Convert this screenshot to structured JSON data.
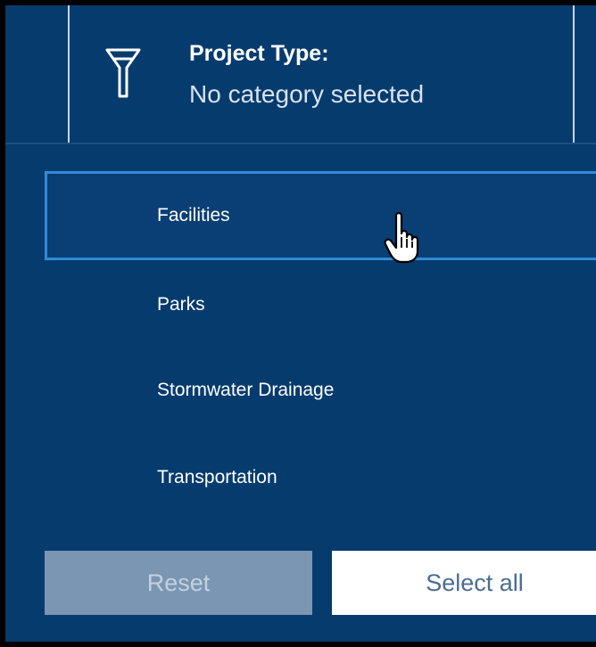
{
  "header": {
    "title": "Project Type:",
    "subtitle": "No category selected",
    "icon": "filter-icon"
  },
  "options": [
    {
      "label": "Facilities",
      "hovered": true
    },
    {
      "label": "Parks",
      "hovered": false
    },
    {
      "label": "Stormwater Drainage",
      "hovered": false
    },
    {
      "label": "Transportation",
      "hovered": false
    }
  ],
  "buttons": {
    "reset_label": "Reset",
    "select_all_label": "Select all"
  },
  "colors": {
    "background": "#063b6e",
    "hover_border": "#2f8bd8",
    "reset_bg": "#7a96b3",
    "select_all_bg": "#ffffff"
  }
}
